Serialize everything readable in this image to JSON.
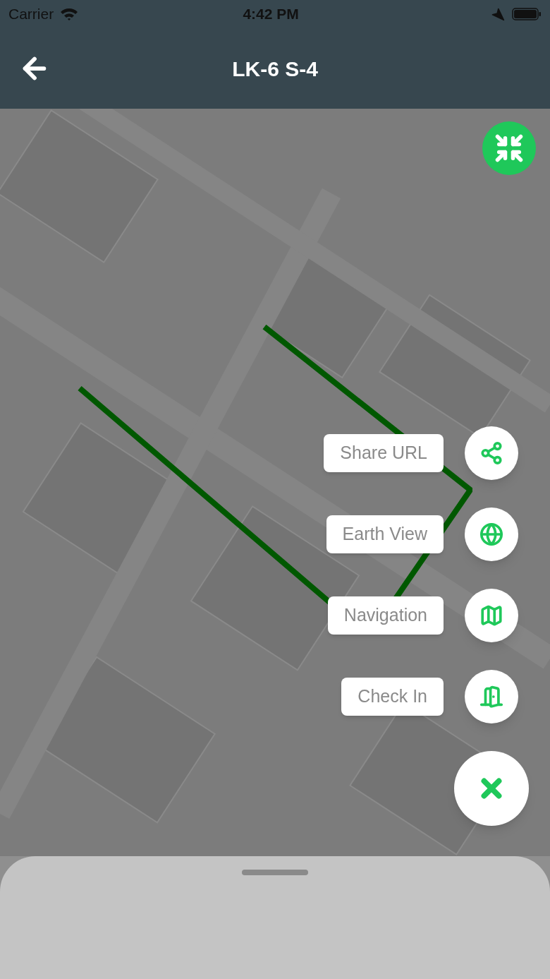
{
  "status_bar": {
    "carrier": "Carrier",
    "time": "4:42 PM"
  },
  "header": {
    "title": "LK-6 S-4"
  },
  "actions": [
    {
      "label": "Share URL",
      "kind": "share"
    },
    {
      "label": "Earth View",
      "kind": "globe"
    },
    {
      "label": "Navigation",
      "kind": "map"
    },
    {
      "label": "Check In",
      "kind": "door"
    }
  ]
}
